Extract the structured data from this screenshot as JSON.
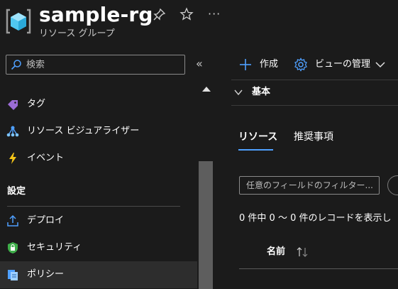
{
  "header": {
    "title": "sample-rg",
    "subtitle": "リソース グループ",
    "more_label": "···"
  },
  "search": {
    "placeholder": "検索",
    "collapse_glyph": "«"
  },
  "sidebar": {
    "items": [
      {
        "label": "タグ",
        "icon": "tag-icon"
      },
      {
        "label": "リソース ビジュアライザー",
        "icon": "resource-visualizer-icon"
      },
      {
        "label": "イベント",
        "icon": "lightning-icon"
      },
      {
        "label": "デプロイ",
        "icon": "deploy-icon"
      },
      {
        "label": "セキュリティ",
        "icon": "shield-icon"
      },
      {
        "label": "ポリシー",
        "icon": "policy-icon"
      }
    ],
    "section_settings": "設定",
    "selected_item": "ポリシー"
  },
  "commandbar": {
    "create_label": "作成",
    "view_label": "ビューの管理"
  },
  "essentials": {
    "label": "基本"
  },
  "tabs": [
    {
      "label": "リソース",
      "selected": true
    },
    {
      "label": "推奨事項",
      "selected": false
    }
  ],
  "filter": {
    "placeholder": "任意のフィールドのフィルター..."
  },
  "records_text": "0 件中 0 ～ 0 件のレコードを表示し",
  "table": {
    "columns": [
      "名前"
    ]
  },
  "colors": {
    "background": "#1b1b1b",
    "accent": "#4fa0ff",
    "selected_row": "#2d2d2d"
  }
}
